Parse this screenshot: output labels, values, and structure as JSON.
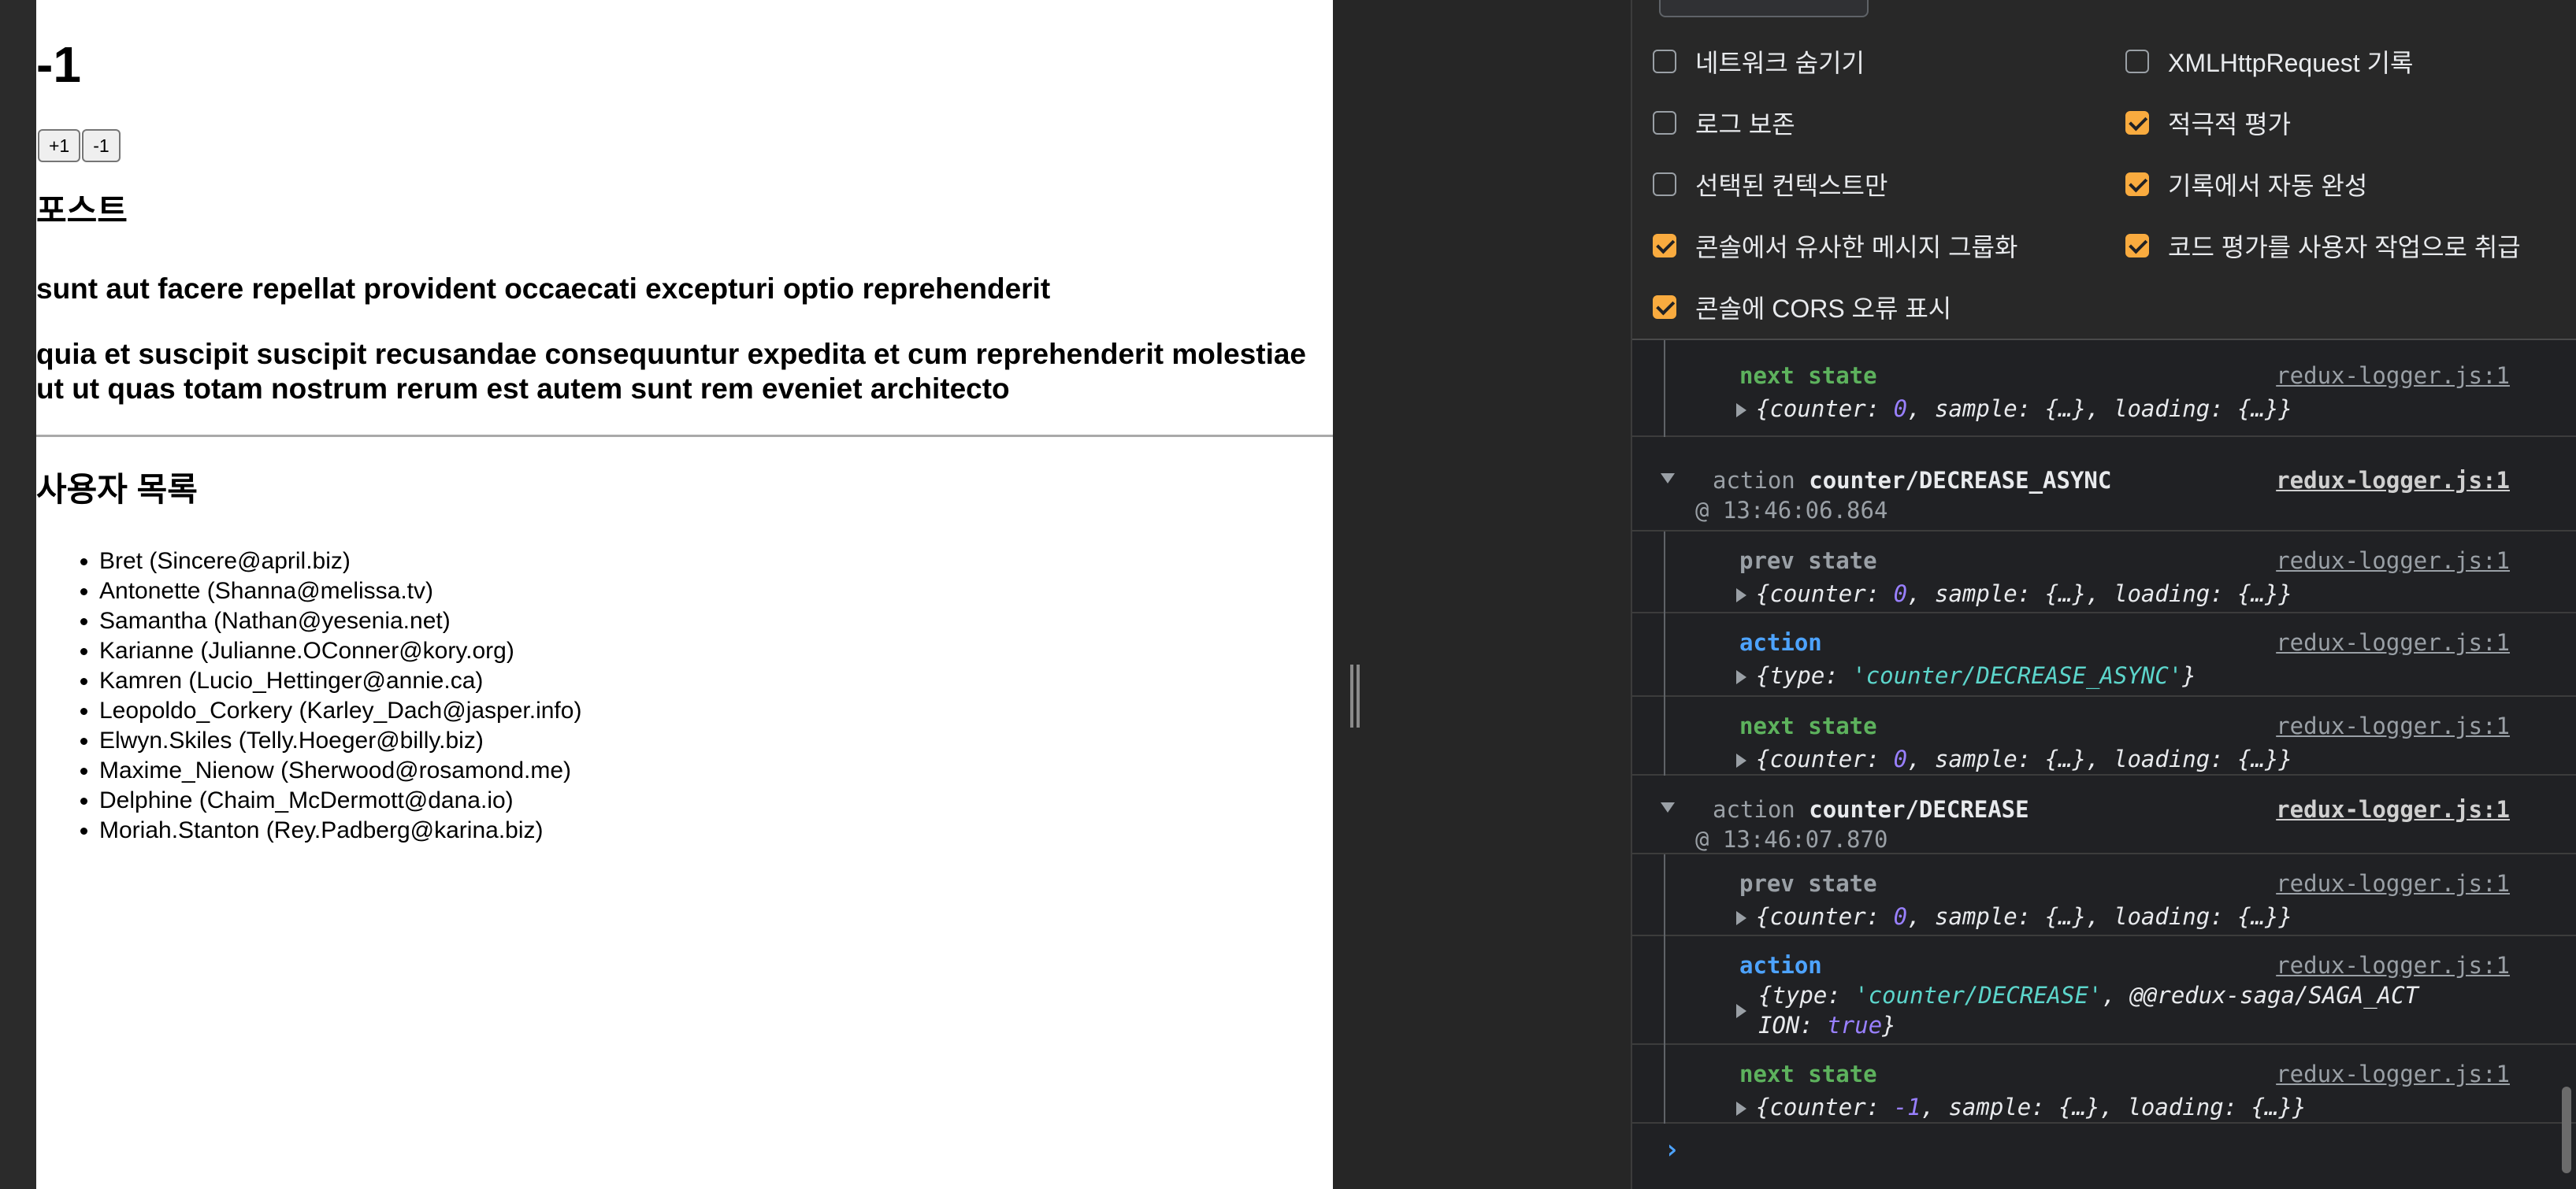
{
  "app": {
    "counter_value": "-1",
    "buttons": {
      "increase": "+1",
      "decrease": "-1"
    },
    "posts_title": "포스트",
    "posts": [
      "sunt aut facere repellat provident occaecati excepturi optio reprehenderit",
      "quia et suscipit suscipit recusandae consequuntur expedita et cum reprehenderit molestiae ut ut quas totam nostrum rerum est autem sunt rem eveniet architecto"
    ],
    "users_title": "사용자 목록",
    "users": [
      "Bret (Sincere@april.biz)",
      "Antonette (Shanna@melissa.tv)",
      "Samantha (Nathan@yesenia.net)",
      "Karianne (Julianne.OConner@kory.org)",
      "Kamren (Lucio_Hettinger@annie.ca)",
      "Leopoldo_Corkery (Karley_Dach@jasper.info)",
      "Elwyn.Skiles (Telly.Hoeger@billy.biz)",
      "Maxime_Nienow (Sherwood@rosamond.me)",
      "Delphine (Chaim_McDermott@dana.io)",
      "Moriah.Stanton (Rey.Padberg@karina.biz)"
    ]
  },
  "devtools": {
    "settings": {
      "hide_network": {
        "label": "네트워크 숨기기",
        "checked": false
      },
      "log_xhr": {
        "label": "XMLHttpRequest 기록",
        "checked": false
      },
      "preserve_log": {
        "label": "로그 보존",
        "checked": false
      },
      "eager_eval": {
        "label": "적극적 평가",
        "checked": true
      },
      "selected_context": {
        "label": "선택된 컨텍스트만",
        "checked": false
      },
      "autocomplete": {
        "label": "기록에서 자동 완성",
        "checked": true
      },
      "group_similar": {
        "label": "콘솔에서 유사한 메시지 그룹화",
        "checked": true
      },
      "user_activation": {
        "label": "코드 평가를 사용자 작업으로 취급",
        "checked": true
      },
      "cors_errors": {
        "label": "콘솔에 CORS 오류 표시",
        "checked": true
      }
    },
    "source": "redux-logger.js:1",
    "labels": {
      "prev": "prev state",
      "action": "action",
      "next": "next state"
    },
    "obj_keys": {
      "counter": "counter",
      "sample": "sample",
      "loading": "loading",
      "type": "type"
    },
    "collapsed": "{…}",
    "group_word": "action",
    "groups": [
      {
        "name": "counter/DECREASE_ASYNC",
        "time": "@ 13:46:06.864",
        "action_type": "'counter/DECREASE_ASYNC'"
      },
      {
        "name": "counter/DECREASE",
        "time": "@ 13:46:07.870",
        "action_type": "'counter/DECREASE'",
        "extra_key_1": "@@redux-saga/SAGA_ACT",
        "extra_key_2": "ION",
        "extra_val": "true"
      }
    ],
    "counter_zero": "0",
    "counter_minus_one": "-1",
    "prompt": "›",
    "colors": {
      "checkbox": "#f9ab3f",
      "prev_label": "#9aa0a6",
      "action_label": "#4da3ff",
      "next_label": "#5db25d",
      "string": "#5cd5cb",
      "number": "#9980ff"
    }
  }
}
